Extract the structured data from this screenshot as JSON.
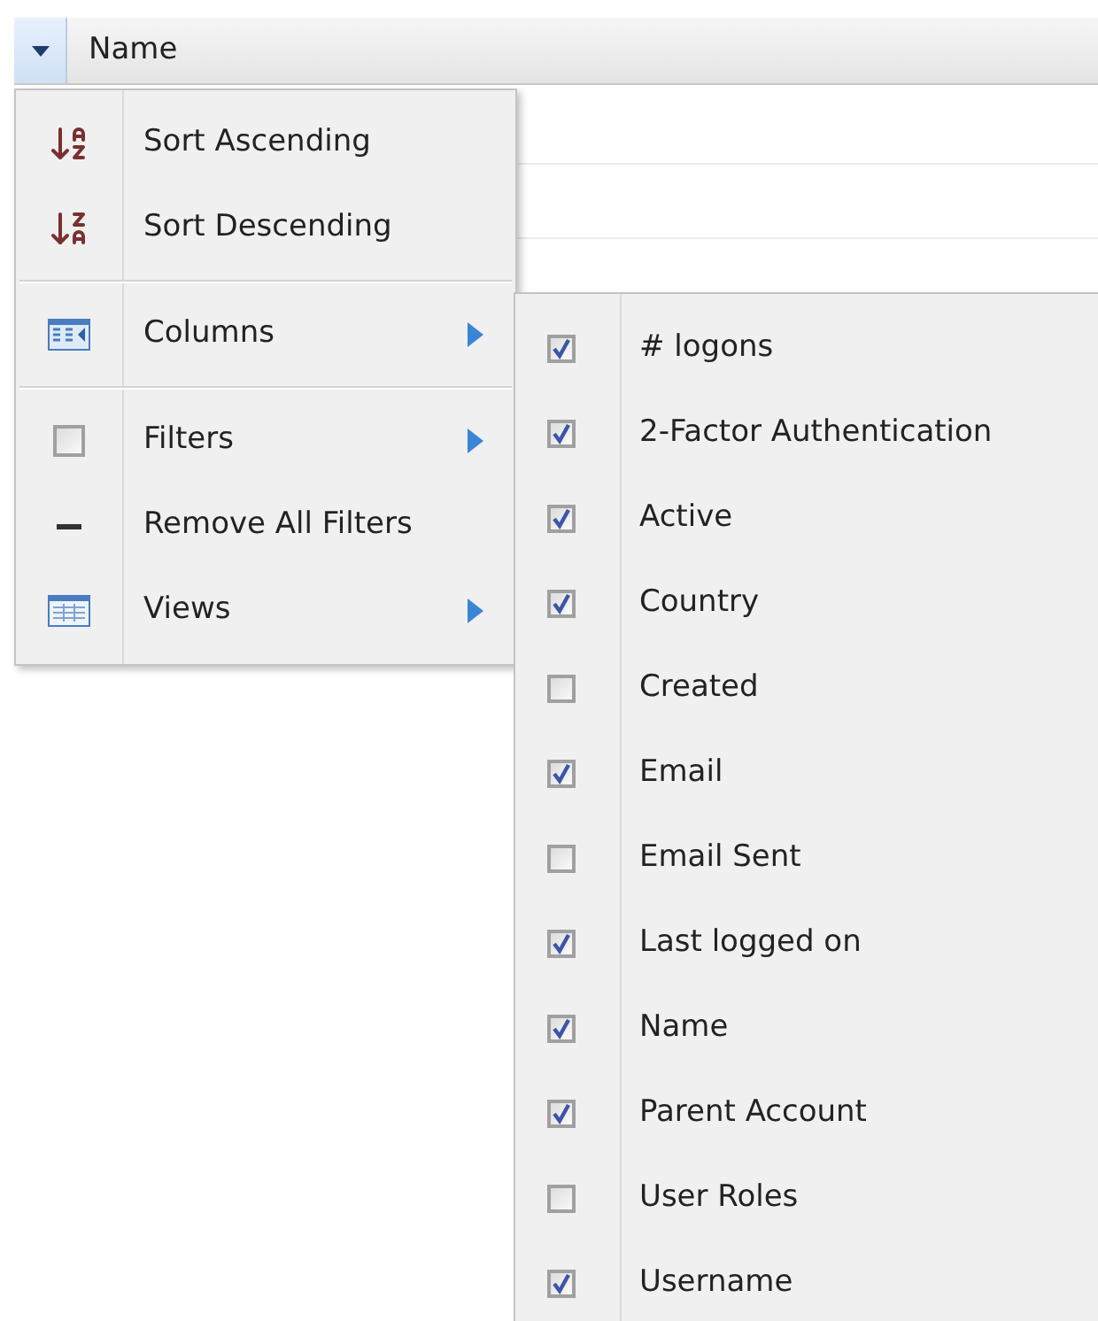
{
  "grid": {
    "header": {
      "label": "Name"
    }
  },
  "menu": {
    "items": [
      {
        "kind": "sort-ascending",
        "label": "Sort Ascending",
        "submenu": false,
        "separator_after": false
      },
      {
        "kind": "sort-descending",
        "label": "Sort Descending",
        "submenu": false,
        "separator_after": true
      },
      {
        "kind": "columns",
        "label": "Columns",
        "submenu": true,
        "separator_after": true
      },
      {
        "kind": "filters",
        "label": "Filters",
        "submenu": true,
        "separator_after": false
      },
      {
        "kind": "remove-filters",
        "label": "Remove All Filters",
        "submenu": false,
        "separator_after": false
      },
      {
        "kind": "views",
        "label": "Views",
        "submenu": true,
        "separator_after": false
      }
    ]
  },
  "columns_menu": {
    "items": [
      {
        "label": "# logons",
        "checked": true
      },
      {
        "label": "2-Factor Authentication",
        "checked": true
      },
      {
        "label": "Active",
        "checked": true
      },
      {
        "label": "Country",
        "checked": true
      },
      {
        "label": "Created",
        "checked": false
      },
      {
        "label": "Email",
        "checked": true
      },
      {
        "label": "Email Sent",
        "checked": false
      },
      {
        "label": "Last logged on",
        "checked": true
      },
      {
        "label": "Name",
        "checked": true
      },
      {
        "label": "Parent Account",
        "checked": true
      },
      {
        "label": "User Roles",
        "checked": false
      },
      {
        "label": "Username",
        "checked": true
      }
    ]
  }
}
